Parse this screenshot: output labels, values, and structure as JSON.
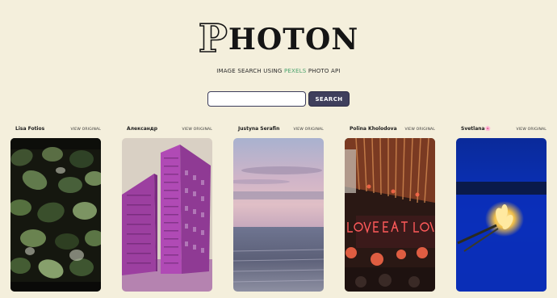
{
  "header": {
    "logo_first": "P",
    "logo_rest": "HOTON",
    "tagline_before": "IMAGE SEARCH USING ",
    "tagline_link": "PEXELS",
    "tagline_after": " PHOTO API"
  },
  "search": {
    "value": "",
    "placeholder": "",
    "button_label": "SEARCH"
  },
  "photos": [
    {
      "author": "Lisa Fotios",
      "link": "VIEW ORIGINAL"
    },
    {
      "author": "Александр",
      "link": "VIEW ORIGINAL"
    },
    {
      "author": "Justyna Serafin",
      "link": "VIEW ORIGINAL"
    },
    {
      "author": "Polina Kholodova",
      "link": "VIEW ORIGINAL"
    },
    {
      "author": "Svetlana🌸",
      "link": "VIEW ORIGINAL"
    }
  ],
  "colors": {
    "background": "#f4efdc",
    "button": "#3f3f5c",
    "link_accent": "#4aa36d"
  }
}
